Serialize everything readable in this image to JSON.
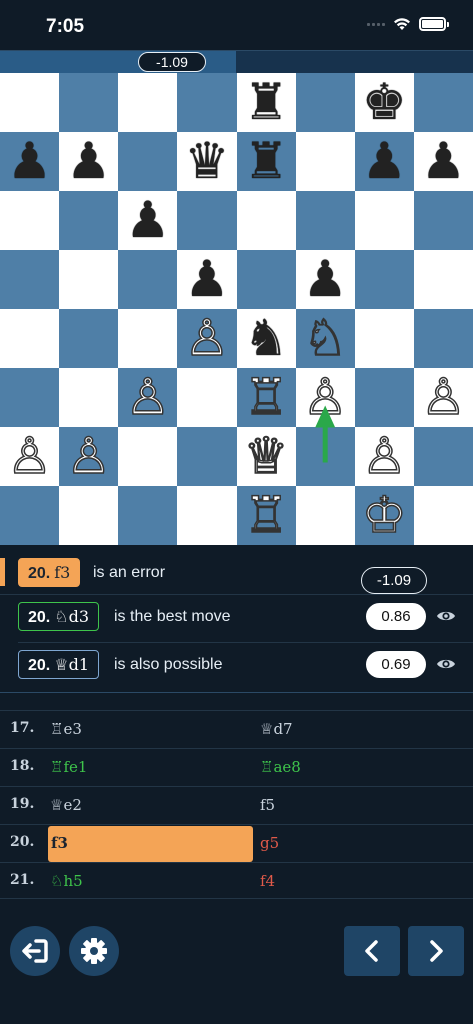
{
  "status": {
    "time": "7:05"
  },
  "evaluation": {
    "score": "-1.09"
  },
  "board": {
    "squares_light": "#ffffff",
    "squares_dark": "#4f7fa7",
    "pieces": [
      {
        "sq": "e8",
        "p": "♜",
        "c": "b",
        "name": "black-rook-e8"
      },
      {
        "sq": "g8",
        "p": "♚",
        "c": "b",
        "name": "black-king-g8"
      },
      {
        "sq": "a7",
        "p": "♟",
        "c": "b",
        "name": "black-pawn-a7"
      },
      {
        "sq": "b7",
        "p": "♟",
        "c": "b",
        "name": "black-pawn-b7"
      },
      {
        "sq": "d7",
        "p": "♛",
        "c": "b",
        "name": "black-queen-d7"
      },
      {
        "sq": "e7",
        "p": "♜",
        "c": "b",
        "name": "black-rook-e7"
      },
      {
        "sq": "g7",
        "p": "♟",
        "c": "b",
        "name": "black-pawn-g7"
      },
      {
        "sq": "h7",
        "p": "♟",
        "c": "b",
        "name": "black-pawn-h7"
      },
      {
        "sq": "c6",
        "p": "♟",
        "c": "b",
        "name": "black-pawn-c6"
      },
      {
        "sq": "d5",
        "p": "♟",
        "c": "b",
        "name": "black-pawn-d5"
      },
      {
        "sq": "f5",
        "p": "♟",
        "c": "b",
        "name": "black-pawn-f5"
      },
      {
        "sq": "d4",
        "p": "♙",
        "c": "w",
        "name": "white-pawn-d4"
      },
      {
        "sq": "e4",
        "p": "♞",
        "c": "b",
        "name": "black-knight-e4"
      },
      {
        "sq": "f4",
        "p": "♘",
        "c": "w",
        "name": "white-knight-f4"
      },
      {
        "sq": "c3",
        "p": "♙",
        "c": "w",
        "name": "white-pawn-c3"
      },
      {
        "sq": "e3",
        "p": "♖",
        "c": "w",
        "name": "white-rook-e3"
      },
      {
        "sq": "f3",
        "p": "♙",
        "c": "w",
        "name": "white-pawn-f3"
      },
      {
        "sq": "h3",
        "p": "♙",
        "c": "w",
        "name": "white-pawn-h3"
      },
      {
        "sq": "a2",
        "p": "♙",
        "c": "w",
        "name": "white-pawn-a2"
      },
      {
        "sq": "b2",
        "p": "♙",
        "c": "w",
        "name": "white-pawn-b2"
      },
      {
        "sq": "e2",
        "p": "♕",
        "c": "w",
        "name": "white-queen-e2"
      },
      {
        "sq": "g2",
        "p": "♙",
        "c": "w",
        "name": "white-pawn-g2"
      },
      {
        "sq": "e1",
        "p": "♖",
        "c": "w",
        "name": "white-rook-e1"
      },
      {
        "sq": "g1",
        "p": "♔",
        "c": "w",
        "name": "white-king-g1"
      }
    ],
    "arrow": {
      "from": "f2",
      "to": "f3",
      "color": "#2aa84a"
    }
  },
  "analysis": {
    "error": {
      "num": "20.",
      "move": "f3",
      "text": "is an error",
      "score": "-1.09"
    },
    "best": {
      "num": "20.",
      "move": "♘d3",
      "text": "is the best move",
      "score": "0.86"
    },
    "alt": {
      "num": "20.",
      "move": "♕d1",
      "text": "is also possible",
      "score": "0.69"
    }
  },
  "moves": [
    {
      "num": "17.",
      "white": "♖e3",
      "black": "♕d7",
      "wclass": "",
      "bclass": ""
    },
    {
      "num": "18.",
      "white": "♖fe1",
      "black": "♖ae8",
      "wclass": "good",
      "bclass": "good"
    },
    {
      "num": "19.",
      "white": "♕e2",
      "black": "f5",
      "wclass": "",
      "bclass": ""
    },
    {
      "num": "20.",
      "white": "f3",
      "black": "g5",
      "wclass": "current",
      "bclass": "bad"
    },
    {
      "num": "21.",
      "white": "♘h5",
      "black": "f4",
      "wclass": "good",
      "bclass": "bad"
    }
  ],
  "colors": {
    "accent_orange": "#f4a456",
    "good_green": "#3ec44b",
    "bad_red": "#e05a4a",
    "button_blue": "#1f4566"
  },
  "controls": {
    "exit_icon": "exit-icon",
    "settings_icon": "gear-icon",
    "prev_icon": "chevron-left-icon",
    "next_icon": "chevron-right-icon"
  }
}
